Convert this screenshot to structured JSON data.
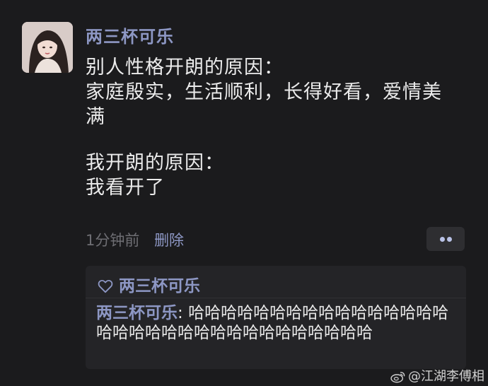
{
  "post": {
    "author": "两三杯可乐",
    "lines": [
      "别人性格开朗的原因：",
      "家庭殷实，生活顺利，长得好看，爱情美",
      "满",
      "",
      "我开朗的原因：",
      "我看开了"
    ],
    "time": "1分钟前",
    "delete_label": "删除"
  },
  "reply": {
    "liked_by": "两三杯可乐",
    "comment_author": "两三杯可乐",
    "comment_separator": ": ",
    "comment_text": "哈哈哈哈哈哈哈哈哈哈哈哈哈哈哈哈哈哈哈哈哈哈哈哈哈哈哈哈哈哈哈哈哈"
  },
  "watermark": "@江湖李傅相",
  "icons": {
    "avatar": "user-photo",
    "more": "more-dots-icon",
    "like": "heart-outline-icon",
    "watermark": "weibo-logo-icon"
  }
}
